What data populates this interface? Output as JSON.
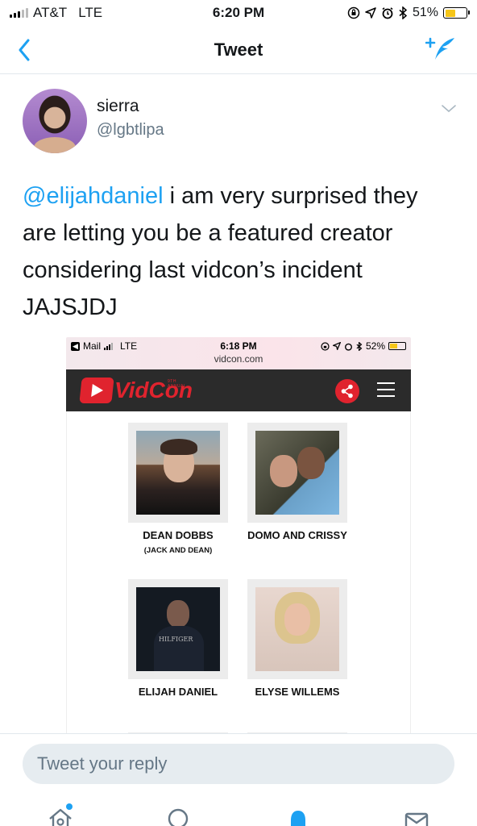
{
  "status_bar": {
    "carrier": "AT&T",
    "network": "LTE",
    "time": "6:20 PM",
    "battery_percent": "51%",
    "battery_level": 0.51
  },
  "nav": {
    "title": "Tweet",
    "back_icon": "chevron-left-icon",
    "compose_icon": "compose-tweet-icon"
  },
  "tweet": {
    "author_name": "sierra",
    "author_handle": "@lgbtlipa",
    "mention": "@elijahdaniel",
    "text": " i am very surprised they are letting you be a featured creator considering last vidcon’s incident JAJSJDJ"
  },
  "media": {
    "status": {
      "back_label": "Mail",
      "network": "LTE",
      "time": "6:18 PM",
      "url": "vidcon.com",
      "battery_percent": "52%",
      "battery_level": 0.52
    },
    "logo": {
      "vid": "Vid",
      "con": "Con",
      "annual": "9TH ANNUAL"
    },
    "creators": [
      {
        "name": "DEAN DOBBS",
        "sub": "(JACK AND DEAN)"
      },
      {
        "name": "DOMO AND CRISSY",
        "sub": ""
      },
      {
        "name": "ELIJAH DANIEL",
        "sub": "",
        "shirt_text": "HILFIGER"
      },
      {
        "name": "ELYSE WILLEMS",
        "sub": ""
      }
    ]
  },
  "reply": {
    "placeholder": "Tweet your reply"
  },
  "tabs": [
    {
      "icon": "home-icon"
    },
    {
      "icon": "search-icon"
    },
    {
      "icon": "notifications-icon"
    },
    {
      "icon": "messages-icon"
    }
  ],
  "colors": {
    "twitter_blue": "#1da1f2",
    "vidcon_red": "#e0232e"
  }
}
